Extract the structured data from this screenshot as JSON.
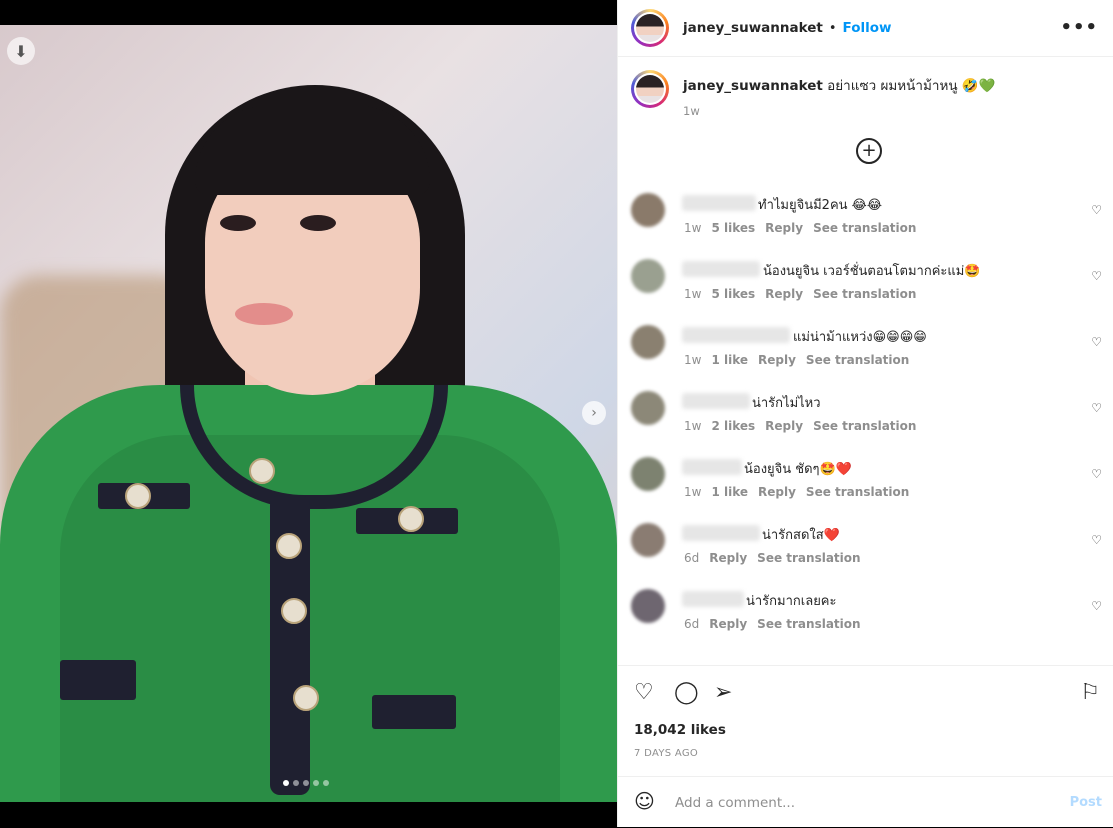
{
  "post": {
    "username": "janey_suwannaket",
    "follow_label": "Follow",
    "bullet": "•",
    "more_label": "•••",
    "caption_text": "อย่าแซว ผมหน้าม้าหนู 🤣💚",
    "caption_time": "1w"
  },
  "media": {
    "download_icon": "download-icon",
    "next_icon": "chevron-right-icon",
    "slides": 5,
    "active_slide": 1
  },
  "comments": [
    {
      "text": "ทำไมยูจินมี2คน 😂😂",
      "time": "1w",
      "likes": "5 likes",
      "reply": "Reply",
      "translate": "See translation"
    },
    {
      "text": "น้องนยูจิน เวอร์ชั่นตอนโตมากค่ะแม่🤩",
      "time": "1w",
      "likes": "5 likes",
      "reply": "Reply",
      "translate": "See translation"
    },
    {
      "text": "แม่น่าม้าแหว่ง😁😁😁😁",
      "time": "1w",
      "likes": "1 like",
      "reply": "Reply",
      "translate": "See translation"
    },
    {
      "text": "น่ารักไม่ไหว",
      "time": "1w",
      "likes": "2 likes",
      "reply": "Reply",
      "translate": "See translation"
    },
    {
      "text": "น้องยูจิน ชัดๆ🤩❤️",
      "time": "1w",
      "likes": "1 like",
      "reply": "Reply",
      "translate": "See translation"
    },
    {
      "text": "น่ารักสดใส❤️",
      "time": "6d",
      "likes": "",
      "reply": "Reply",
      "translate": "See translation"
    },
    {
      "text": "น่ารักมากเลยคะ",
      "time": "6d",
      "likes": "",
      "reply": "Reply",
      "translate": "See translation"
    }
  ],
  "stats": {
    "likes": "18,042 likes",
    "date": "7 DAYS AGO"
  },
  "compose": {
    "placeholder": "Add a comment...",
    "post_label": "Post"
  },
  "colors": {
    "accent": "#0095f6",
    "post_disabled": "#b3dbff",
    "muted": "#8e8e8e"
  }
}
